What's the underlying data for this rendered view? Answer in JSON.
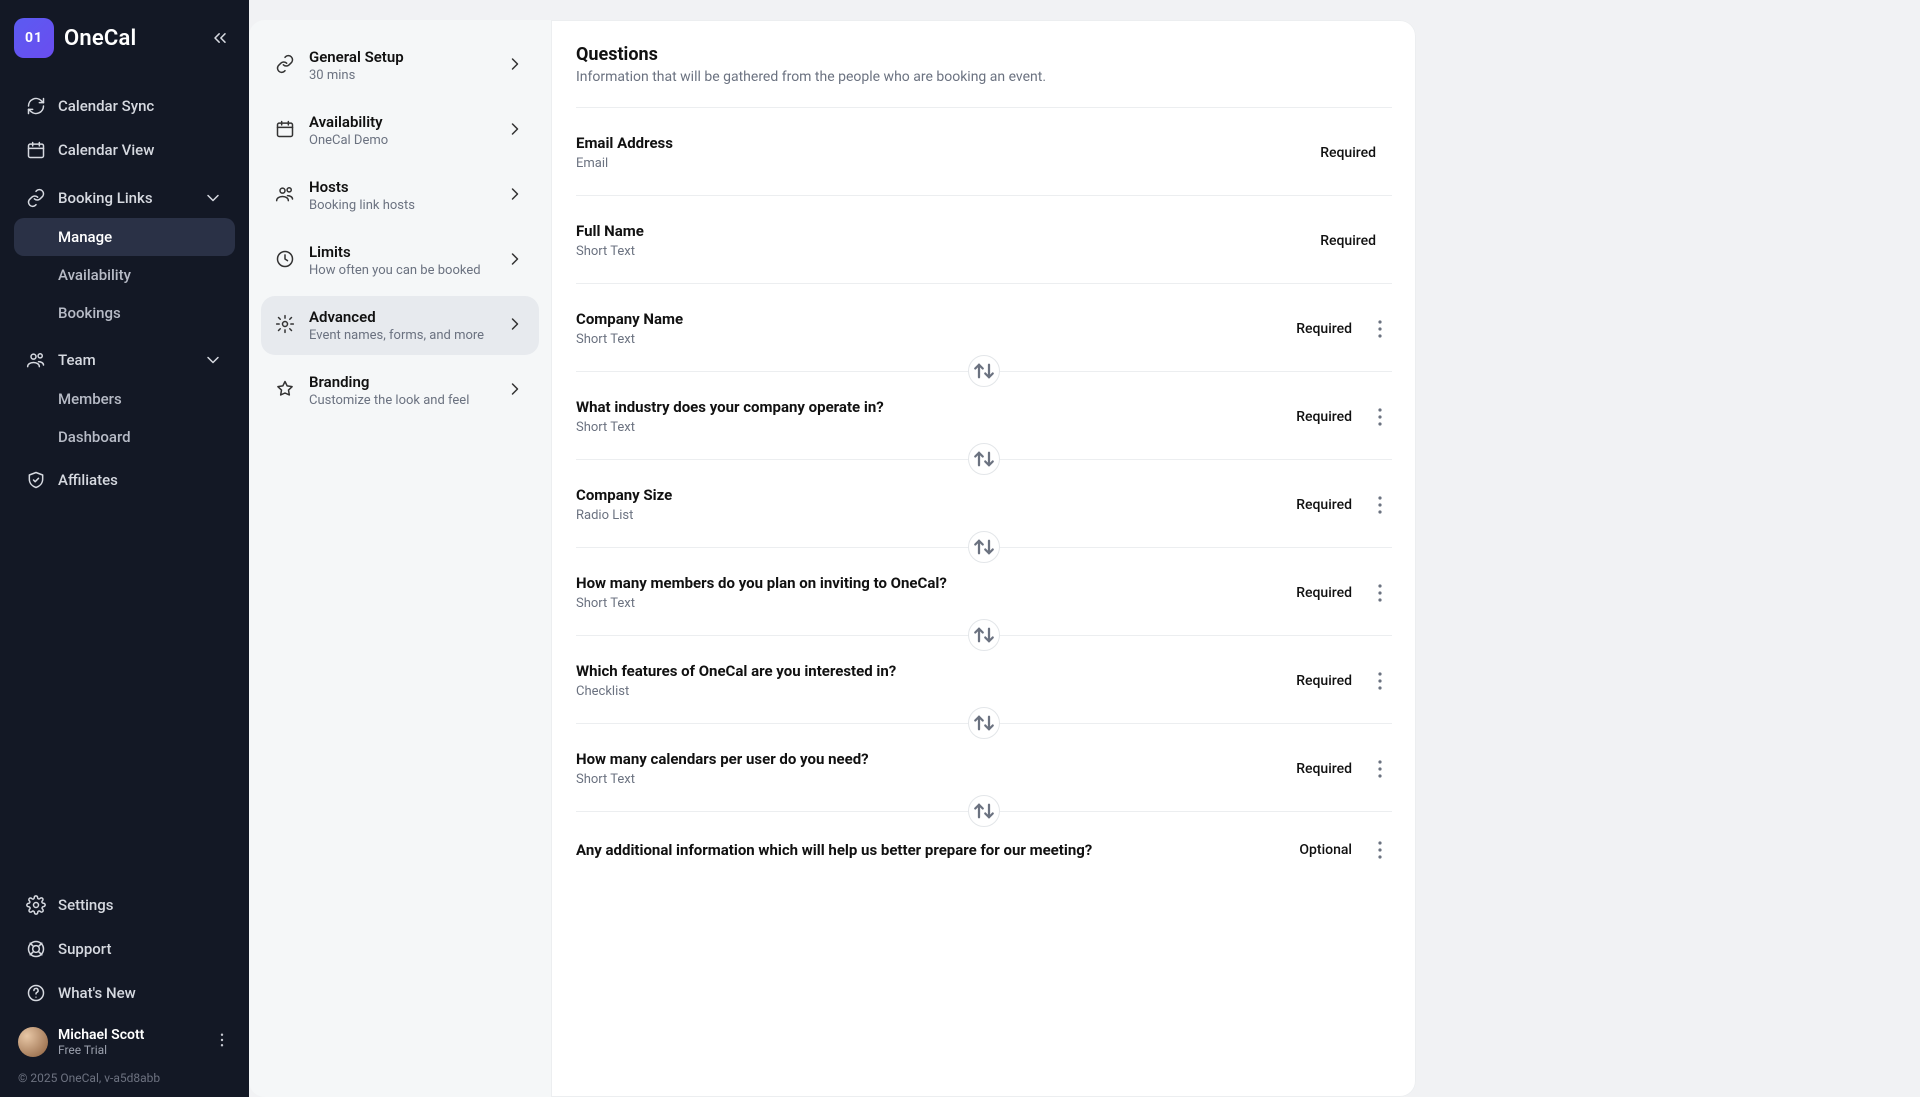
{
  "brand": {
    "logo_text": "01",
    "name": "OneCal"
  },
  "sidebar": {
    "items": [
      {
        "id": "calendar-sync",
        "label": "Calendar Sync"
      },
      {
        "id": "calendar-view",
        "label": "Calendar View"
      },
      {
        "id": "booking-links",
        "label": "Booking Links",
        "expandable": true,
        "children": [
          {
            "id": "manage",
            "label": "Manage",
            "active": true
          },
          {
            "id": "availability",
            "label": "Availability"
          },
          {
            "id": "bookings",
            "label": "Bookings"
          }
        ]
      },
      {
        "id": "team",
        "label": "Team",
        "expandable": true,
        "children": [
          {
            "id": "members",
            "label": "Members"
          },
          {
            "id": "dashboard",
            "label": "Dashboard"
          }
        ]
      },
      {
        "id": "affiliates",
        "label": "Affiliates"
      }
    ],
    "bottom": [
      {
        "id": "settings",
        "label": "Settings"
      },
      {
        "id": "support",
        "label": "Support"
      },
      {
        "id": "whatsnew",
        "label": "What's New"
      }
    ],
    "user": {
      "name": "Michael Scott",
      "plan": "Free Trial"
    },
    "copyright": "© 2025 OneCal, v-a5d8abb"
  },
  "sub_sidebar": [
    {
      "id": "general-setup",
      "title": "General Setup",
      "sub": "30 mins",
      "icon": "link"
    },
    {
      "id": "availability",
      "title": "Availability",
      "sub": "OneCal Demo",
      "icon": "calendar"
    },
    {
      "id": "hosts",
      "title": "Hosts",
      "sub": "Booking link hosts",
      "icon": "users"
    },
    {
      "id": "limits",
      "title": "Limits",
      "sub": "How often you can be booked",
      "icon": "clock"
    },
    {
      "id": "advanced",
      "title": "Advanced",
      "sub": "Event names, forms, and more",
      "icon": "gear",
      "active": true
    },
    {
      "id": "branding",
      "title": "Branding",
      "sub": "Customize the look and feel",
      "icon": "star"
    }
  ],
  "main": {
    "title": "Questions",
    "desc": "Information that will be gathered from the people who are booking an event.",
    "required_label": "Required",
    "optional_label": "Optional",
    "questions": [
      {
        "title": "Email Address",
        "type": "Email",
        "status": "Required",
        "locked": true,
        "swap": false
      },
      {
        "title": "Full Name",
        "type": "Short Text",
        "status": "Required",
        "locked": true,
        "swap": false
      },
      {
        "title": "Company Name",
        "type": "Short Text",
        "status": "Required",
        "locked": false,
        "swap": true
      },
      {
        "title": "What industry does your company operate in?",
        "type": "Short Text",
        "status": "Required",
        "locked": false,
        "swap": true
      },
      {
        "title": "Company Size",
        "type": "Radio List",
        "status": "Required",
        "locked": false,
        "swap": true
      },
      {
        "title": "How many members do you plan on inviting to OneCal?",
        "type": "Short Text",
        "status": "Required",
        "locked": false,
        "swap": true
      },
      {
        "title": "Which features of OneCal are you interested in?",
        "type": "Checklist",
        "status": "Required",
        "locked": false,
        "swap": true
      },
      {
        "title": "How many calendars per user do you need?",
        "type": "Short Text",
        "status": "Required",
        "locked": false,
        "swap": true
      },
      {
        "title": "Any additional information which will help us better prepare for our meeting?",
        "type": "",
        "status": "Optional",
        "locked": false,
        "swap": false
      }
    ]
  }
}
